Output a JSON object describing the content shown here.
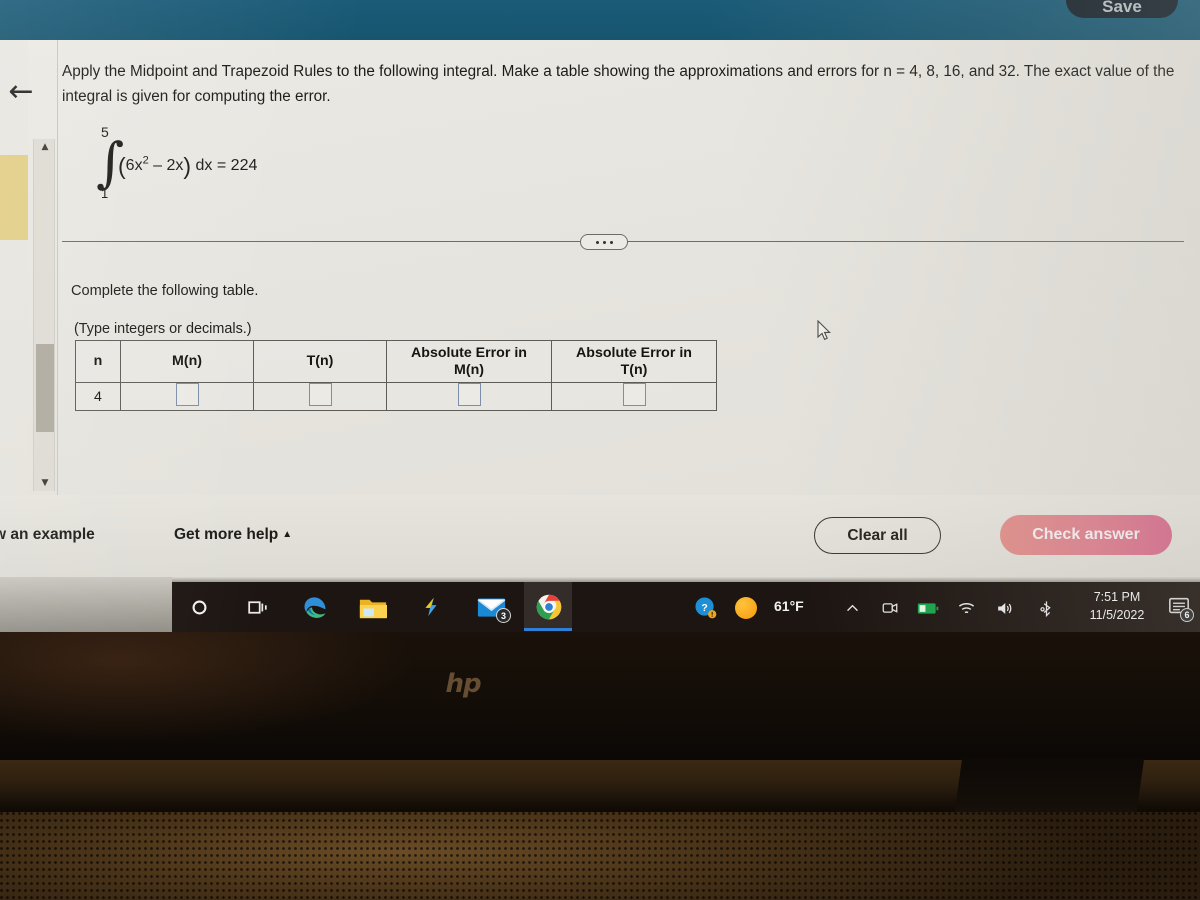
{
  "app": {
    "header_color": "#17556f",
    "save_label": "Save"
  },
  "problem": {
    "statement": "Apply the Midpoint and Trapezoid Rules to the following integral. Make a table showing the approximations and errors for n = 4, 8, 16, and 32. The exact value of the integral is given for computing the error.",
    "integral": {
      "upper_limit": "5",
      "lower_limit": "1",
      "integrand_prefix": "6x",
      "integrand_exponent": "2",
      "integrand_suffix": "– 2x",
      "differential": "dx = 224"
    },
    "ellipsis_label": "•••"
  },
  "instructions": {
    "complete_table": "Complete the following table.",
    "type_note": "(Type integers or decimals.)"
  },
  "table": {
    "headers": [
      "n",
      "M(n)",
      "T(n)",
      "Absolute Error in M(n)",
      "Absolute Error in T(n)"
    ],
    "header_lines": [
      [
        "n"
      ],
      [
        "M(n)"
      ],
      [
        "T(n)"
      ],
      [
        "Absolute Error in",
        "M(n)"
      ],
      [
        "Absolute Error in",
        "T(n)"
      ]
    ],
    "rows": [
      {
        "n": "4",
        "m": "",
        "t": "",
        "err_m": "",
        "err_t": ""
      }
    ]
  },
  "actions": {
    "show_example": "w an example",
    "get_more_help": "Get more help",
    "get_more_help_caret": "▲",
    "clear_all": "Clear all",
    "check_answer": "Check answer",
    "check_answer_color": "#d76a8d"
  },
  "taskbar": {
    "icons": [
      {
        "name": "search-icon",
        "glyph": "○",
        "badge": ""
      },
      {
        "name": "task-view-icon",
        "glyph": "⧉",
        "badge": ""
      },
      {
        "name": "edge-browser-icon",
        "glyph": "",
        "badge": ""
      },
      {
        "name": "file-explorer-icon",
        "glyph": "",
        "badge": ""
      },
      {
        "name": "lightning-app-icon",
        "glyph": "⚡",
        "badge": ""
      },
      {
        "name": "mail-icon",
        "glyph": "",
        "badge": "3"
      },
      {
        "name": "chrome-browser-icon",
        "glyph": "",
        "badge": ""
      }
    ],
    "help_icon": "?",
    "weather": {
      "icon": "sun-icon",
      "temperature": "61°F"
    },
    "tray": [
      "chevron-up-icon",
      "meet-now-icon",
      "battery-icon",
      "wifi-icon",
      "volume-icon",
      "bluetooth-icon"
    ],
    "clock": {
      "time": "7:51 PM",
      "date": "11/5/2022"
    },
    "notification_count": "6"
  },
  "hardware": {
    "brand_logo": "hp"
  }
}
